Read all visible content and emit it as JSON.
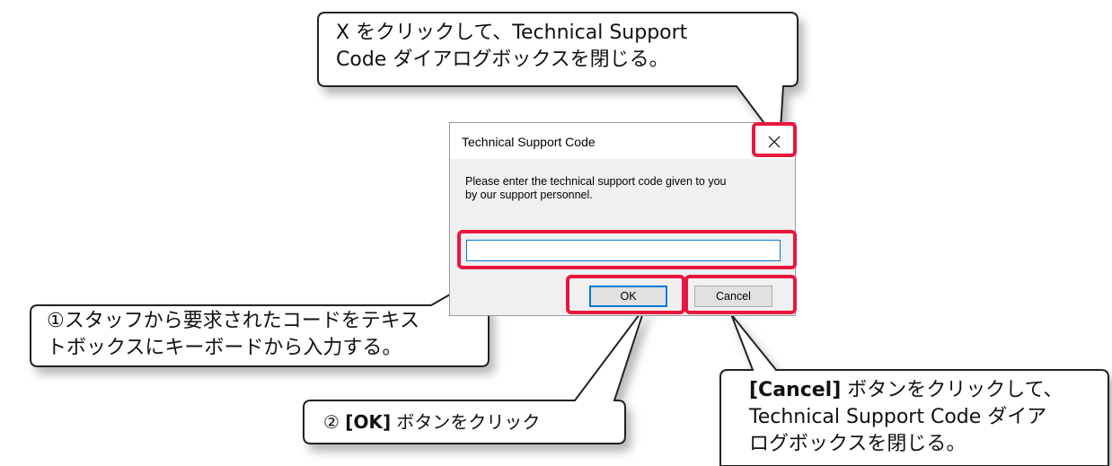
{
  "dialog": {
    "title": "Technical Support Code",
    "prompt_line1": "Please enter the technical support code given to you",
    "prompt_line2": "by our support personnel.",
    "input_value": "",
    "ok_label": "OK",
    "cancel_label": "Cancel"
  },
  "callouts": {
    "close": {
      "line1": "X をクリックして、Technical Support",
      "line2": "Code ダイアログボックスを閉じる。"
    },
    "input": {
      "line1": "①スタッフから要求されたコードをテキス",
      "line2": "トボックスにキーボードから入力する。"
    },
    "ok": {
      "prefix": "② ",
      "bold": "[OK]",
      "suffix": " ボタンをクリック"
    },
    "cancel": {
      "bold": "[Cancel]",
      "line1_rest": " ボタンをクリックして、",
      "line2": "Technical Support Code ダイア",
      "line3": "ログボックスを閉じる。"
    }
  },
  "colors": {
    "highlight": "#e8173f",
    "focus_blue": "#0078d7",
    "dialog_bg": "#f0f0f0"
  }
}
